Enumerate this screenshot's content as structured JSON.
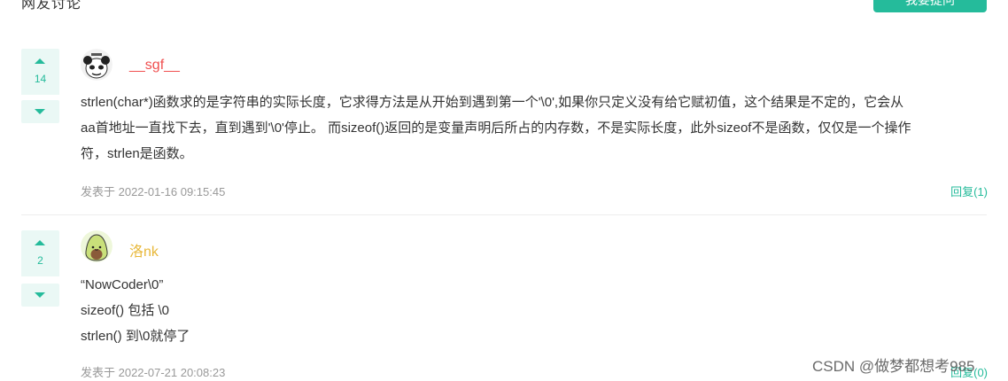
{
  "header": {
    "label": "网友讨论",
    "button_label": "我要提问"
  },
  "comments": [
    {
      "votes": "14",
      "username": "__sgf__",
      "avatar_icon": "panda-meme-avatar",
      "lines": [
        "strlen(char*)函数求的是字符串的实际长度，它求得方法是从开始到遇到第一个'\\0',如果你只定义没有给它赋初值，这个结果是不定的，它会从",
        "aa首地址一直找下去，直到遇到'\\0'停止。 而sizeof()返回的是变量声明后所占的内存数，不是实际长度，此外sizeof不是函数，仅仅是一个操作",
        "符，strlen是函数。"
      ],
      "posted": "发表于 2022-01-16 09:15:45",
      "reply": "回复(1)"
    },
    {
      "votes": "2",
      "username": "洛nk",
      "avatar_icon": "avocado-avatar",
      "lines": [
        "“NowCoder\\0”",
        "sizeof() 包括 \\0",
        "strlen() 到\\0就停了"
      ],
      "posted": "发表于 2022-07-21 20:08:23",
      "reply": "回复(0)"
    }
  ],
  "watermark": "CSDN @做梦都想考985",
  "colors": {
    "accent": "#25bb9b",
    "vote_bg": "#eaf8f5",
    "username_1": "#f04e4e",
    "username_2": "#e8b83a"
  }
}
